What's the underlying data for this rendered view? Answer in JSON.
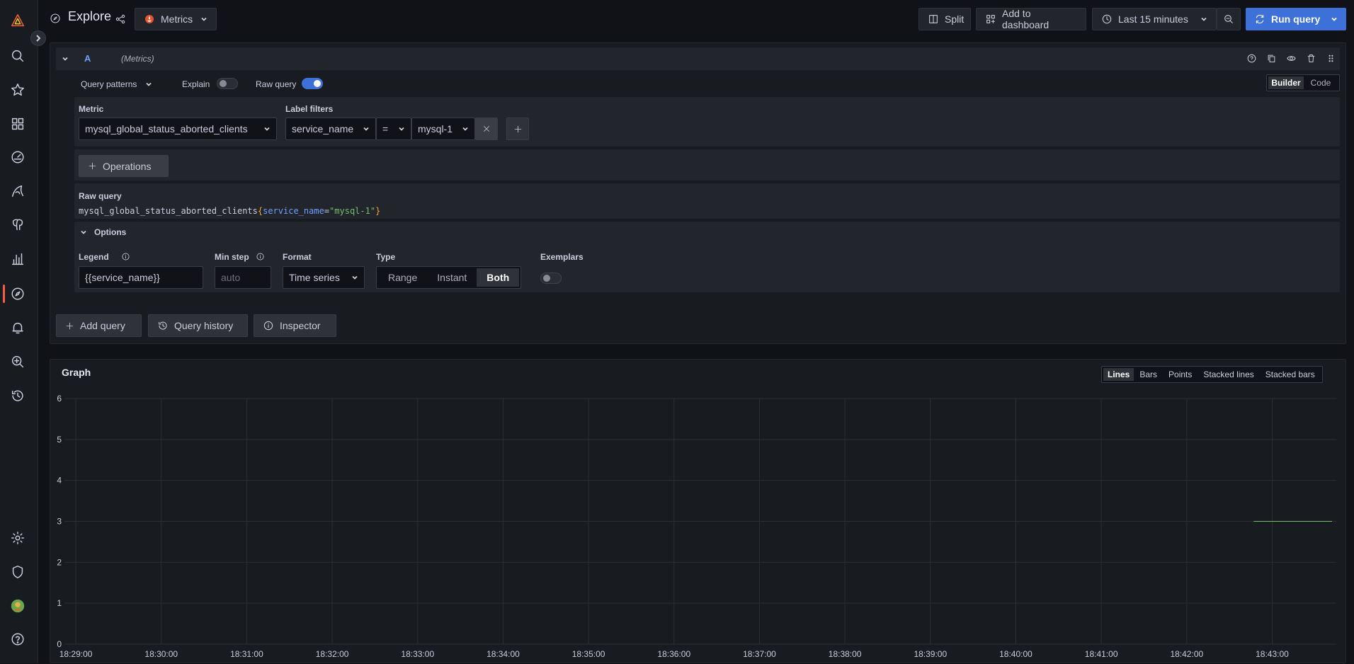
{
  "topbar": {
    "title": "Explore",
    "datasource": "Metrics",
    "split_label": "Split",
    "add_to_dashboard_label": "Add to dashboard",
    "time_range": "Last 15 minutes",
    "run_query_label": "Run query"
  },
  "query": {
    "ref_id": "A",
    "datasource_hint": "(Metrics)",
    "query_patterns_label": "Query patterns",
    "explain_label": "Explain",
    "explain_on": false,
    "raw_query_label": "Raw query",
    "raw_query_on": true,
    "editor_modes": [
      "Builder",
      "Code"
    ],
    "editor_mode_selected": "Builder",
    "metric_label": "Metric",
    "metric_value": "mysql_global_status_aborted_clients",
    "label_filters_label": "Label filters",
    "filter_label": "service_name",
    "filter_operator": "=",
    "filter_value": "mysql-1",
    "operations_label": "Operations",
    "raw_query_title": "Raw query",
    "raw_query_metric": "mysql_global_status_aborted_clients",
    "raw_query_open": "{",
    "raw_query_key": "service_name",
    "raw_query_eq": "=",
    "raw_query_val": "\"mysql-1\"",
    "raw_query_close": "}",
    "options_label": "Options",
    "legend_label": "Legend",
    "legend_value": "{{service_name}}",
    "min_step_label": "Min step",
    "min_step_placeholder": "auto",
    "format_label": "Format",
    "format_value": "Time series",
    "type_label": "Type",
    "type_options": [
      "Range",
      "Instant",
      "Both"
    ],
    "type_selected": "Both",
    "exemplars_label": "Exemplars",
    "exemplars_on": false
  },
  "actions": {
    "add_query": "Add query",
    "query_history": "Query history",
    "inspector": "Inspector"
  },
  "graph": {
    "title": "Graph",
    "view_options": [
      "Lines",
      "Bars",
      "Points",
      "Stacked lines",
      "Stacked bars"
    ],
    "view_selected": "Lines"
  },
  "colors": {
    "accent": "#3d71d9",
    "series": "#73bf69",
    "brand": "#f55f3e"
  },
  "chart_data": {
    "type": "line",
    "title": "",
    "xlabel": "",
    "ylabel": "",
    "ylim": [
      0,
      6
    ],
    "yticks": [
      "0",
      "1",
      "2",
      "3",
      "4",
      "5",
      "6"
    ],
    "xticks": [
      "18:29:00",
      "18:30:00",
      "18:31:00",
      "18:32:00",
      "18:33:00",
      "18:34:00",
      "18:35:00",
      "18:36:00",
      "18:37:00",
      "18:38:00",
      "18:39:00",
      "18:40:00",
      "18:41:00",
      "18:42:00",
      "18:43:00"
    ],
    "xrange": [
      "18:28:52",
      "18:43:45"
    ],
    "grid": true,
    "series": [
      {
        "x": [
          "18:42:47",
          "18:43:42"
        ],
        "values": [
          3,
          3
        ]
      }
    ]
  }
}
